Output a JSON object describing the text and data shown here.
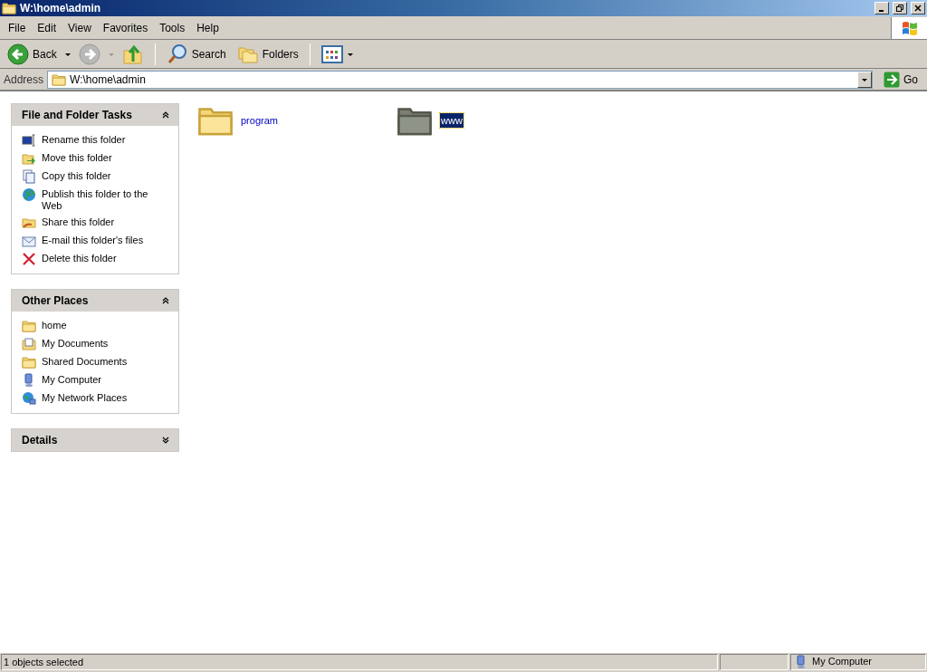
{
  "window": {
    "title": "W:\\home\\admin"
  },
  "menu": [
    "File",
    "Edit",
    "View",
    "Favorites",
    "Tools",
    "Help"
  ],
  "toolbar": {
    "back": "Back",
    "search": "Search",
    "folders": "Folders"
  },
  "address": {
    "label": "Address",
    "value": "W:\\home\\admin",
    "go": "Go"
  },
  "panels": [
    {
      "title": "File and Folder Tasks",
      "expanded": true,
      "items": [
        "Rename this folder",
        "Move this folder",
        "Copy this folder",
        "Publish this folder to the Web",
        "Share this folder",
        "E-mail this folder's files",
        "Delete this folder"
      ]
    },
    {
      "title": "Other Places",
      "expanded": true,
      "items": [
        "home",
        "My Documents",
        "Shared Documents",
        "My Computer",
        "My Network Places"
      ]
    },
    {
      "title": "Details",
      "expanded": false
    }
  ],
  "files": [
    {
      "name": "program",
      "selected": false
    },
    {
      "name": "www",
      "selected": true
    }
  ],
  "status_bar": {
    "message": "1 objects selected",
    "zone": "My Computer"
  }
}
